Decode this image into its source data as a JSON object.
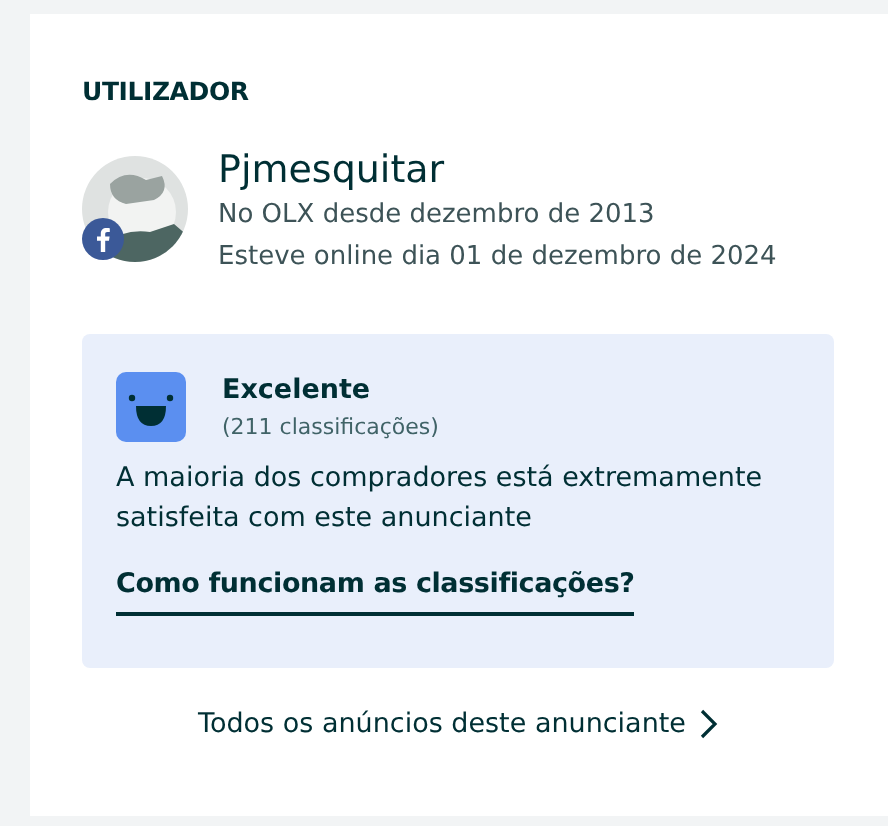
{
  "section_title": "UTILIZADOR",
  "user": {
    "name": "Pjmesquitar",
    "member_since": "No OLX desde dezembro de 2013",
    "last_online": "Esteve online dia 01 de dezembro de 2024"
  },
  "rating": {
    "label": "Excelente",
    "count": "(211 classificações)",
    "description": "A maioria dos compradores está extremamente satisfeita com este anunciante",
    "link": "Como funcionam as classificações?"
  },
  "all_ads_link": "Todos os anúncios deste anunciante"
}
